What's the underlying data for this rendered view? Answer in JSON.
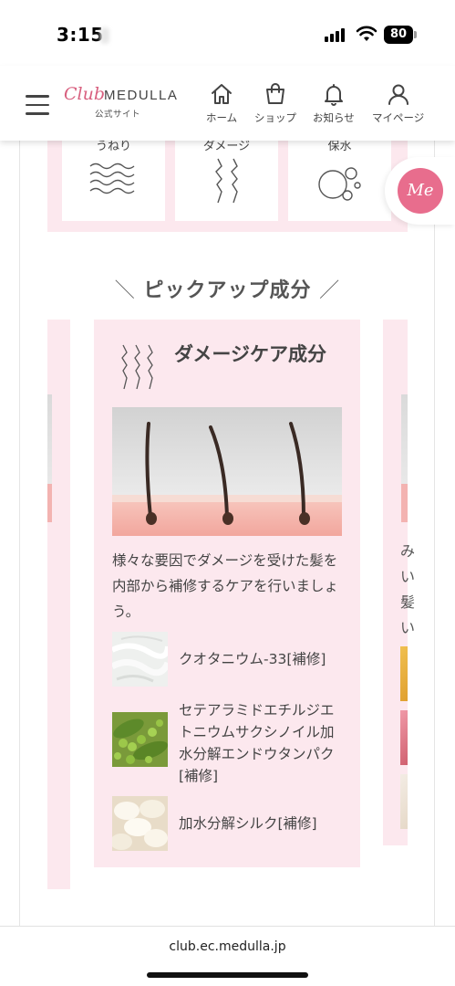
{
  "status": {
    "time": "3:15",
    "battery": "80"
  },
  "header": {
    "logo_script": "Club",
    "logo_brand": "MEDULLA",
    "logo_sub": "公式サイト",
    "nav": [
      {
        "label": "ホーム",
        "icon": "home-icon"
      },
      {
        "label": "ショップ",
        "icon": "shopping-bag-icon"
      },
      {
        "label": "お知らせ",
        "icon": "bell-icon"
      },
      {
        "label": "マイページ",
        "icon": "user-icon"
      }
    ]
  },
  "concerns": [
    {
      "label": "うねり",
      "icon": "wave-icon"
    },
    {
      "label": "ダメージ",
      "icon": "damage-icon"
    },
    {
      "label": "保水",
      "icon": "bubbles-icon"
    }
  ],
  "me_button": {
    "label": "Me"
  },
  "section": {
    "slash_left": "＼",
    "title": "ピックアップ成分",
    "slash_right": "／"
  },
  "main_card": {
    "title": "ダメージケア成分",
    "description": "様々な要因でダメージを受けた髪を内部から補修するケアを行いましょう。",
    "ingredients": [
      {
        "name": "クオタニウム-33[補修]",
        "thumb": "cream-texture"
      },
      {
        "name": "セテアラミドエチルジエトニウムサクシノイル加水分解エンドウタンパク[補修]",
        "thumb": "green-peas"
      },
      {
        "name": "加水分解シルク[補修]",
        "thumb": "silk-cocoons"
      }
    ]
  },
  "right_card": {
    "chars": [
      "み",
      "い",
      "髪",
      "い"
    ]
  },
  "url_bar": {
    "url": "club.ec.medulla.jp"
  },
  "colors": {
    "accent_pink": "#e86d8d",
    "card_bg": "#fce8ee",
    "logo_pink": "#d8607f"
  }
}
